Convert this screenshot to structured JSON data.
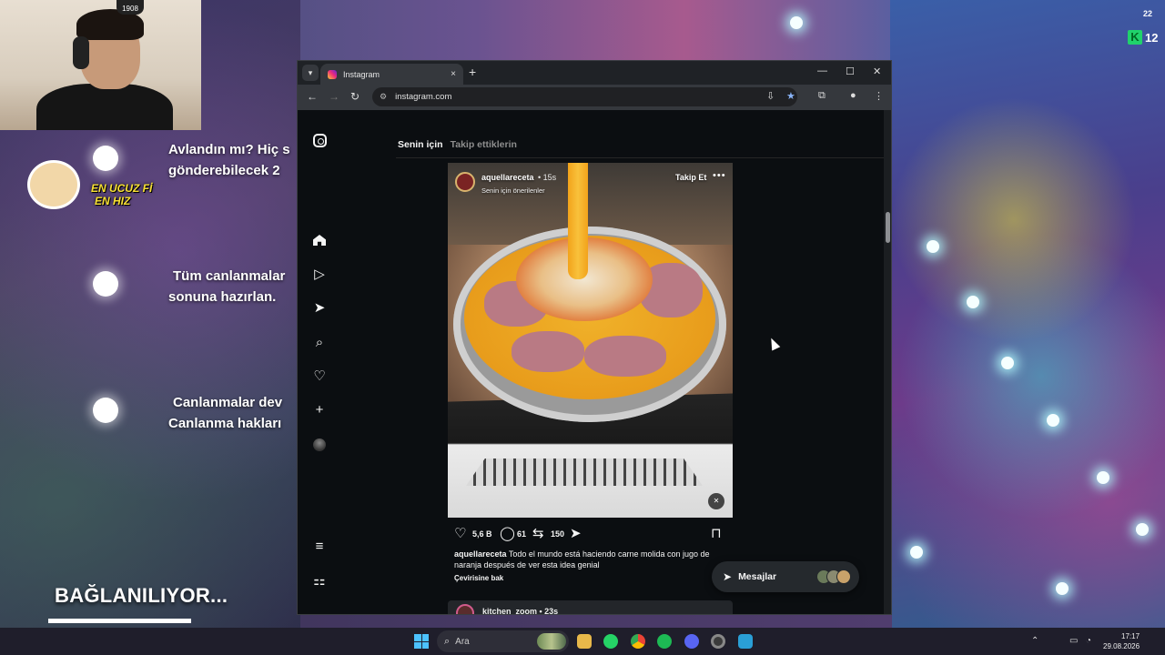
{
  "overlay": {
    "webcam_badge": "1908",
    "line1a": "Avlandın mı? Hiç s",
    "line1b": "gönderebilecek 2",
    "line2a": "Tüm canlanmalar",
    "line2b": "sonuna hazırlan.",
    "line3a": "Canlanmalar dev",
    "line3b": "Canlanma hakları",
    "logo_line1": "EN UCUZ Fİ",
    "logo_line2": "EN HIZ",
    "connecting": "BAĞLANILIYOR...",
    "corner_number": "22",
    "k_badge": "K",
    "k_value": "12"
  },
  "browser": {
    "tab_title": "Instagram",
    "url": "instagram.com",
    "new_tab_symbol": "+",
    "close_symbol": "×"
  },
  "instagram": {
    "feed_tabs": [
      "Senin için",
      "Takip ettiklerin"
    ],
    "post": {
      "username": "aquellareceta",
      "time": "• 15s",
      "subtitle": "Senin için önerilenler",
      "follow": "Takip Et",
      "likes": "5,6 B",
      "comments": "61",
      "reposts": "150",
      "caption_user": "aquellareceta",
      "caption_text": "Todo el mundo está haciendo carne molida con jugo de naranja después de ver esta idea genial",
      "translate": "Çevirisine bak"
    },
    "next_post_username": "kitchen_zoom • 23s",
    "messages_label": "Mesajlar"
  },
  "taskbar": {
    "search_placeholder": "Ara",
    "time": "17:17",
    "date": "29.08.2026"
  },
  "colors": {
    "browser_bg": "#0c0f12",
    "juice": "#f2a31b",
    "accent_blue": "#8ab4f8"
  },
  "icons": [
    "instagram-icon",
    "home-icon",
    "reels-icon",
    "send-icon",
    "search-icon",
    "heart-icon",
    "plus-icon",
    "menu-icon",
    "threads-icon",
    "comment-icon",
    "repost-icon",
    "bookmark-icon",
    "mute-icon"
  ]
}
